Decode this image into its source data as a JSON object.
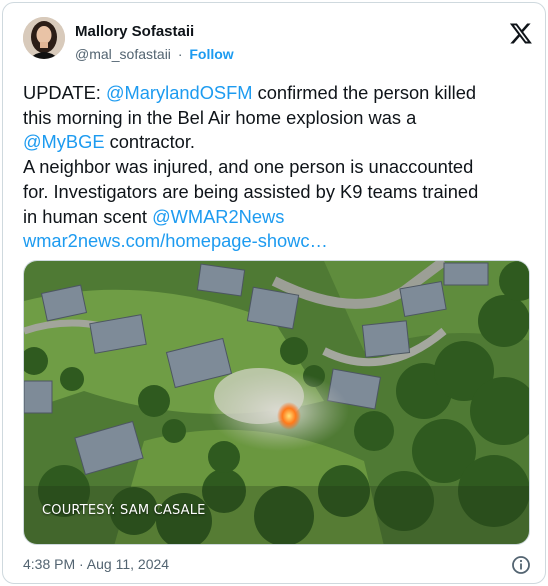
{
  "author": {
    "display_name": "Mallory Sofastaii",
    "handle": "@mal_sofastaii",
    "separator": "·",
    "follow_label": "Follow"
  },
  "tweet": {
    "line1_prefix": "UPDATE: ",
    "line1_mention": "@MarylandOSFM",
    "line1_suffix": " confirmed the person killed",
    "line2": "this morning in the Bel Air home explosion was a",
    "line3_mention": "@MyBGE",
    "line3_suffix": " contractor.",
    "line4": "A neighbor was injured, and one person is unaccounted",
    "line5": "for. Investigators are being assisted by K9 teams trained",
    "line6_prefix": "in human scent ",
    "line6_mention": "@WMAR2News",
    "line7_link": "wmar2news.com/homepage-showc…"
  },
  "media": {
    "caption": "COURTESY: SAM CASALE"
  },
  "footer": {
    "timestamp": "4:38 PM · Aug 11, 2024"
  },
  "icons": {
    "platform": "x-logo-icon",
    "info": "info-icon"
  },
  "colors": {
    "link": "#1d9bf0",
    "text": "#0f1419",
    "muted": "#536471",
    "border": "#cfd9de"
  }
}
